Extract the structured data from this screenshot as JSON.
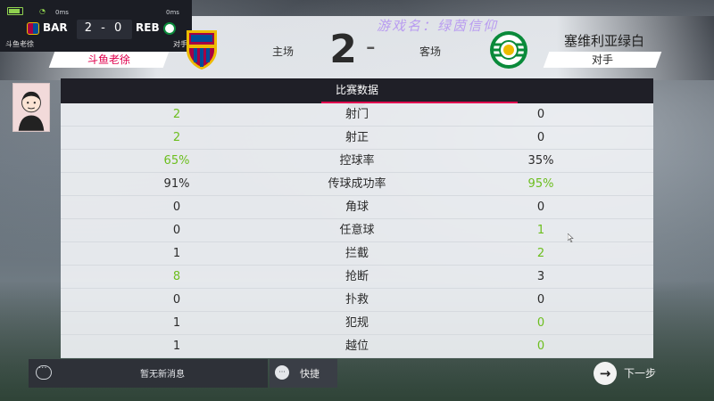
{
  "mini_scoreboard": {
    "home_abbr": "BAR",
    "away_abbr": "REB",
    "score": "2 - 0",
    "ping_left": "0ms",
    "ping_right": "0ms",
    "home_name": "斗鱼老徐",
    "away_name": "对手"
  },
  "watermark": "游戏名：绿茵信仰",
  "header": {
    "home_label": "主场",
    "away_label": "客场",
    "home_score": "2",
    "away_score": "0",
    "score_separator": "-",
    "home_player_tag": "斗鱼老徐",
    "away_team_name": "塞维利亚绿白",
    "away_player_tag": "对手"
  },
  "stats_panel": {
    "title": "比赛数据",
    "rows": [
      {
        "name": "射门",
        "home": "2",
        "away": "0",
        "winner": "home"
      },
      {
        "name": "射正",
        "home": "2",
        "away": "0",
        "winner": "home"
      },
      {
        "name": "控球率",
        "home": "65%",
        "away": "35%",
        "winner": "home"
      },
      {
        "name": "传球成功率",
        "home": "91%",
        "away": "95%",
        "winner": "away"
      },
      {
        "name": "角球",
        "home": "0",
        "away": "0",
        "winner": "none"
      },
      {
        "name": "任意球",
        "home": "0",
        "away": "1",
        "winner": "away"
      },
      {
        "name": "拦截",
        "home": "1",
        "away": "2",
        "winner": "away"
      },
      {
        "name": "抢断",
        "home": "8",
        "away": "3",
        "winner": "home"
      },
      {
        "name": "扑救",
        "home": "0",
        "away": "0",
        "winner": "none"
      },
      {
        "name": "犯规",
        "home": "1",
        "away": "0",
        "winner": "away"
      },
      {
        "name": "越位",
        "home": "1",
        "away": "0",
        "winner": "away"
      }
    ]
  },
  "bottom_bar": {
    "message_text": "暂无新消息",
    "quick_label": "快捷",
    "next_label": "下一步"
  },
  "colors": {
    "accent": "#e0004e",
    "highlight_green": "#6cbe1e",
    "panel_dark": "#1f1f27"
  },
  "icons": {
    "message": "chat-bubble-icon",
    "quick": "quick-chat-icon",
    "next": "arrow-right-icon"
  }
}
